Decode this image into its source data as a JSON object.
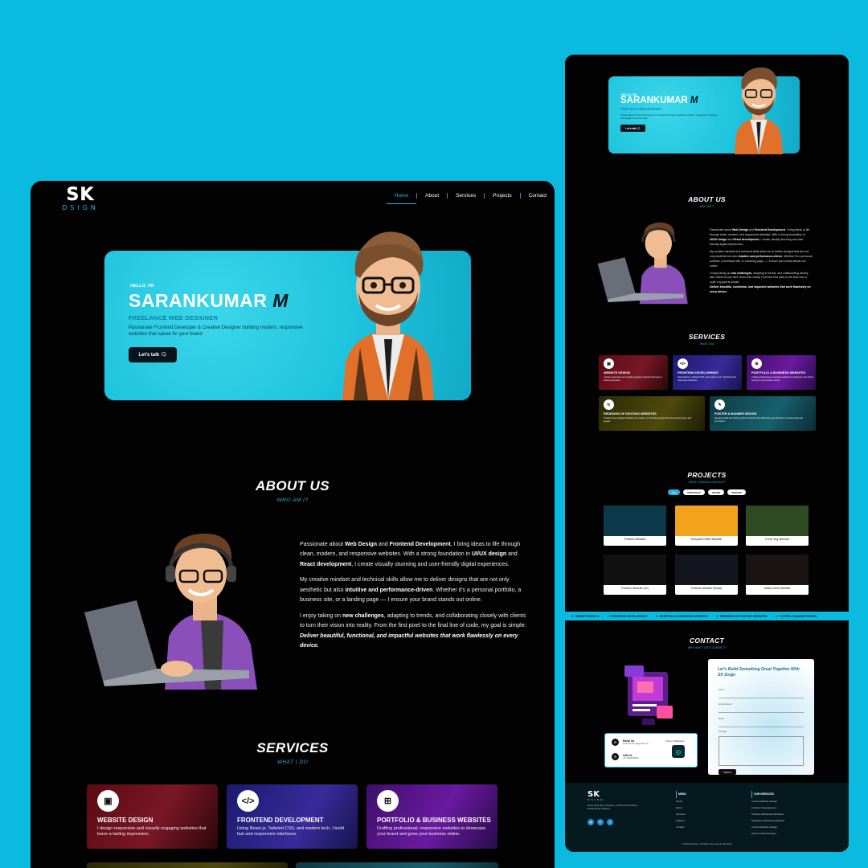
{
  "brand": {
    "logo_top": "SK",
    "logo_bottom": "DSIGN"
  },
  "nav": [
    "Home",
    "About",
    "Services",
    "Projects",
    "Contact"
  ],
  "hero": {
    "hello": "HELLO, I'M",
    "name_first": "SARANKUMAR",
    "name_last": "M",
    "role": "FREELANCE WEB DESIGNER",
    "description": "Passionate Frontend Developer & Creative Designer building modern, responsive websites that speak for your brand",
    "cta": "Let's talk 🗨"
  },
  "about": {
    "title": "ABOUT US",
    "subtitle": "WHO AM I?",
    "p1_a": "Passionate about ",
    "p1_b": "Web Design",
    "p1_c": " and ",
    "p1_d": "Frontend Development",
    "p1_e": ", I bring ideas to life through clean, modern, and responsive websites. With a strong foundation in ",
    "p1_f": "UI/UX design",
    "p1_g": " and ",
    "p1_h": "React development",
    "p1_i": ", I create visually stunning and user-friendly digital experiences.",
    "p2_a": "My creative mindset and technical skills allow me to deliver designs that are not only aesthetic but also ",
    "p2_b": "intuitive and performance-driven",
    "p2_c": ". Whether it's a personal portfolio, a business site, or a landing page — I ensure your brand stands out online.",
    "p3_a": "I enjoy taking on ",
    "p3_b": "new challenges",
    "p3_c": ", adapting to trends, and collaborating closely with clients to turn their vision into reality. From the first pixel to the final line of code, my goal is simple:",
    "p3_em": "Deliver beautiful, functional, and impactful websites that work flawlessly on every device."
  },
  "services": {
    "title": "SERVICES",
    "subtitle": "WHAT I DO",
    "items": [
      {
        "title": "WEBSITE DESIGN",
        "desc": "I design responsive and visually engaging websites that leave a lasting impression.",
        "icon": "monitor-icon",
        "glyph": "▣"
      },
      {
        "title": "FRONTEND DEVELOPMENT",
        "desc": "Using React.js, Tailwind CSS, and modern tech, I build fast and responsive interfaces.",
        "icon": "code-icon",
        "glyph": "</>"
      },
      {
        "title": "PORTFOLIO & BUSINESS WEBSITES",
        "desc": "Crafting professional, responsive websites to showcase your brand and grow your business online.",
        "icon": "briefcase-icon",
        "glyph": "⊞"
      },
      {
        "title": "REDESIGN OF EXISTING WEBSITES",
        "desc": "Transforming outdated websites into modern, user-friendly designs that boost performance and appeal.",
        "icon": "refresh-icon",
        "glyph": "↻"
      },
      {
        "title": "POSTER & BANNER DESIGN",
        "desc": "Designing bold and catchy posters & banners that effectively grab attention on social media and promotions.",
        "icon": "brush-icon",
        "glyph": "✎"
      }
    ]
  },
  "projects": {
    "title": "PROJECTS",
    "subtitle": "WHAT I DESIGN & DEVELOP",
    "filters": [
      "ALL",
      "PORTFOLIO",
      "ONLINE",
      "WEBSITE"
    ],
    "items": [
      {
        "caption": "Portfolio Website",
        "color": "#0a3a4a"
      },
      {
        "caption": "Karupatti Coffee Website",
        "color": "#f2a31b"
      },
      {
        "caption": "Fresh Veg Website",
        "color": "#2e4a22"
      },
      {
        "caption": "Portfolio Website (JS)",
        "color": "#111111"
      },
      {
        "caption": "Portfolio Website (React)",
        "color": "#14161f"
      },
      {
        "caption": "Watch Store Website",
        "color": "#1a1414"
      }
    ]
  },
  "ticker": [
    "WEBSITE DESIGN",
    "FRONTEND DEVELOPMENT",
    "PORTFOLIO & BUSINESS WEBSITES",
    "REDESIGN OF EXISTING WEBSITES",
    "POSTER & BANNER DESIGN"
  ],
  "contact": {
    "title": "CONTACT",
    "subtitle": "WHY WAIT? LET'S CONNECT!",
    "form_title": "Let's Build Something Great Together With SK Dsign",
    "name_label": "Name *",
    "email_label": "Email Address *",
    "phone_label": "Phone",
    "message_label": "Message",
    "submit": "Submit",
    "email_key": "Email Us",
    "email_val": "sarankumarr.m@gmail.com",
    "call_key": "Call Us",
    "call_val": "+91 9843455000",
    "wa_text": "Chat on WhatsApp"
  },
  "footer": {
    "desc": "Every Pixel Has a Purpose – We Build Something Extraordinary Together.",
    "menu_title": "MENU",
    "menu": [
      "Home",
      "About",
      "Services",
      "Projects",
      "Contact"
    ],
    "services_title": "OUR SERVICES",
    "services": [
      "Custom Website Design",
      "Frontend Development",
      "Portfolio & Business Websites",
      "Redesign Of Existing Websites",
      "Custom Website Design",
      "Poster & Brand Design"
    ],
    "copyright": "© 2025 SK Dsign. All Rights Reserved by SK Dsign"
  },
  "colors": {
    "background": "#0bbadf",
    "accent": "#2ab3e0",
    "page": "#020203"
  }
}
